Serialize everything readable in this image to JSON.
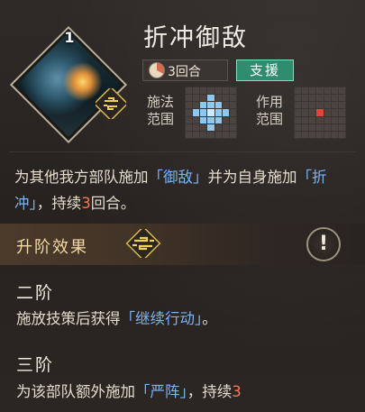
{
  "skill": {
    "level": "1",
    "name": "折冲御敌",
    "duration_label": "3回合",
    "type_tag": "支援",
    "cast_range_label": [
      "施法",
      "范围"
    ],
    "effect_range_label": [
      "作用",
      "范围"
    ]
  },
  "description": {
    "p1": "为其他我方部队施加",
    "token1": "「御敌」",
    "p2": "并为自身施加",
    "token2": "「折冲」",
    "p3": "，持续",
    "num": "3",
    "p4": "回合。"
  },
  "upgrade": {
    "title": "升阶效果",
    "info_icon_glyph": "!"
  },
  "tiers": [
    {
      "title": "二阶",
      "p1": "施放技策后获得",
      "token": "「继续行动」",
      "p2": "。"
    },
    {
      "title": "三阶",
      "p1": "为该部队额外施加",
      "token": "「严阵」",
      "p2": "，持续",
      "num": "3"
    }
  ],
  "colors": {
    "token_blue": "#7ab4f5",
    "number_orange": "#f07a55",
    "support_green": "#2f8c6e",
    "range_blue": "#8cc8f0",
    "range_red": "#e0453a"
  },
  "icons": [
    "skill-portrait-icon",
    "rank-emblem-icon",
    "duration-pie-icon",
    "info-icon"
  ]
}
